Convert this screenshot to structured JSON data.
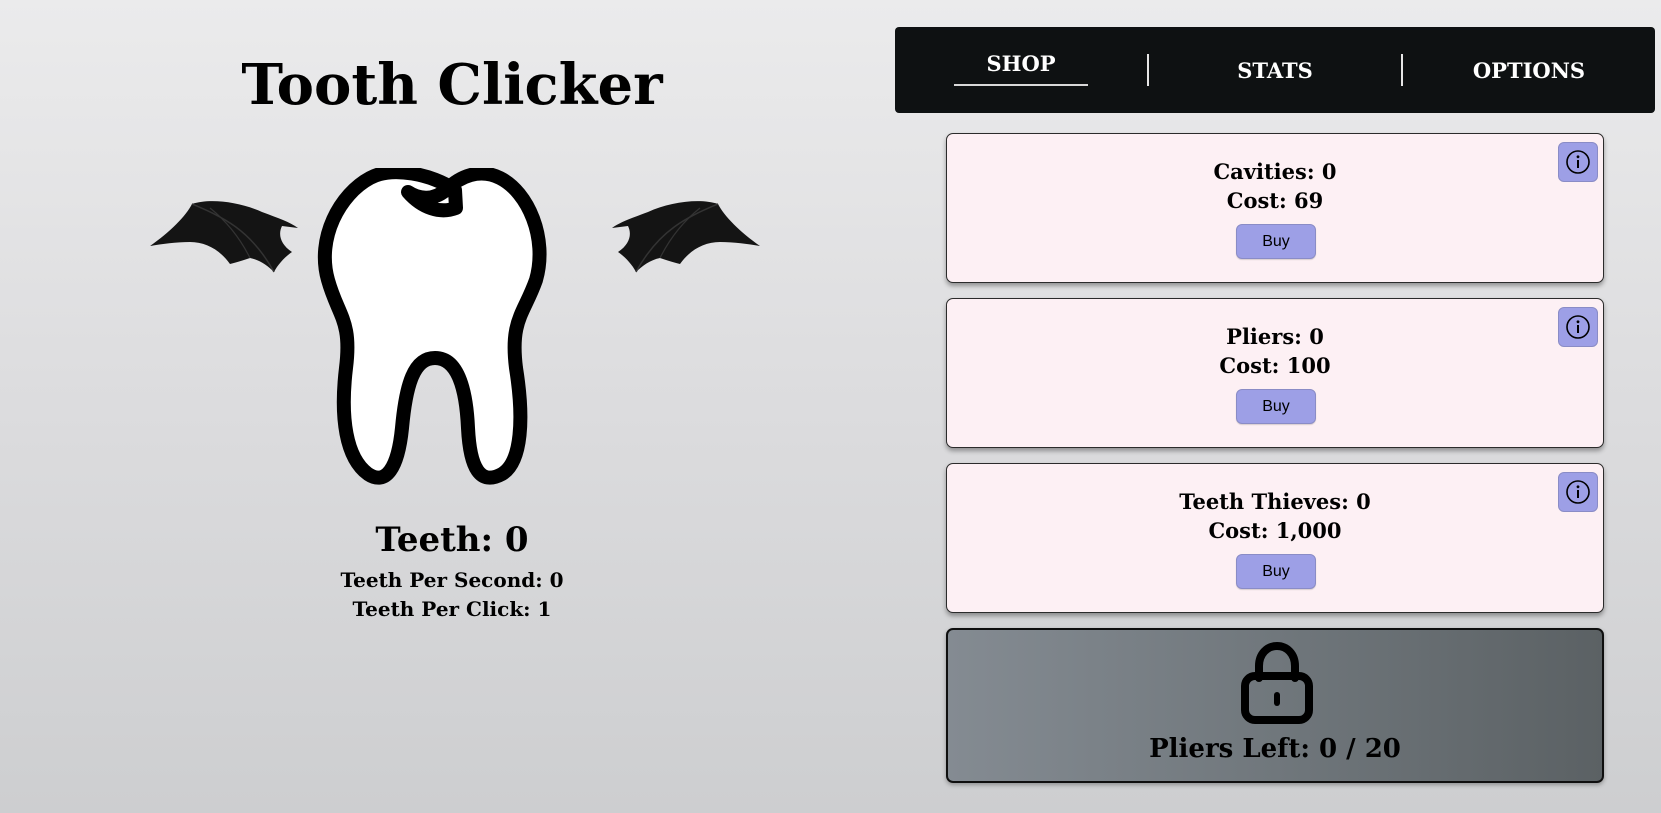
{
  "game": {
    "title": "Tooth Clicker",
    "teeth_label": "Teeth: 0",
    "teeth_per_second_label": "Teeth Per Second: 0",
    "teeth_per_click_label": "Teeth Per Click: 1"
  },
  "tabs": [
    {
      "label": "SHOP",
      "active": true
    },
    {
      "label": "STATS",
      "active": false
    },
    {
      "label": "OPTIONS",
      "active": false
    }
  ],
  "shop": {
    "items": [
      {
        "name_label": "Cavities: 0",
        "cost_label": "Cost: 69",
        "buy_label": "Buy",
        "info_icon": "info-icon"
      },
      {
        "name_label": "Pliers: 0",
        "cost_label": "Cost: 100",
        "buy_label": "Buy",
        "info_icon": "info-icon"
      },
      {
        "name_label": "Teeth Thieves: 0",
        "cost_label": "Cost: 1,000",
        "buy_label": "Buy",
        "info_icon": "info-icon"
      }
    ],
    "locked": {
      "icon": "lock-icon",
      "label": "Pliers Left:  0 / 20"
    }
  },
  "colors": {
    "tab_bar_background": "#0e1112",
    "card_background": "#fdf0f4",
    "button_background": "#9d9fe6",
    "locked_background": "#70777c"
  }
}
